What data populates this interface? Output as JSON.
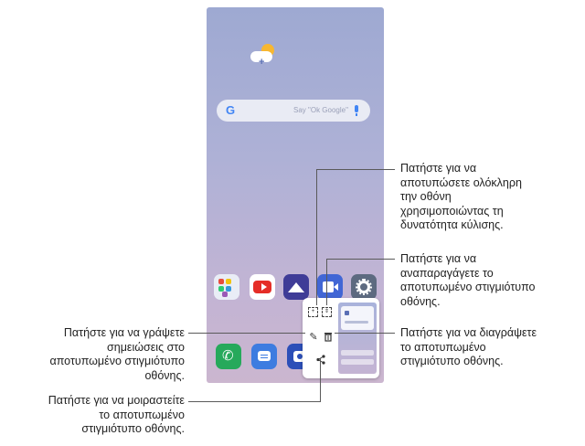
{
  "home_screen": {
    "search_bar": {
      "logo": "G",
      "placeholder": "Say \"Ok Google\""
    },
    "apps_row": [
      "contacts-app",
      "youtube-app",
      "gallery-app",
      "video-app",
      "settings-app"
    ],
    "dock": [
      "phone-app",
      "messages-app",
      "camera-app"
    ]
  },
  "capture_panel": {
    "tools": [
      "capture-plus-icon",
      "extended-capture-icon",
      "edit-icon",
      "delete-icon",
      "share-icon"
    ],
    "glyphs": {
      "edit": "✎",
      "delete": "🗑",
      "share": "<"
    }
  },
  "callouts": {
    "extended": "Πατήστε για να\nαποτυπώσετε ολόκληρη\nτην οθόνη\nχρησιμοποιώντας τη\nδυνατότητα κύλισης.",
    "replay": "Πατήστε για να\nαναπαραγάγετε το\nαποτυπωμένο στιγμιότυπο\nοθόνης.",
    "delete": "Πατήστε για να διαγράψετε\nτο αποτυπωμένο\nστιγμιότυπο οθόνης.",
    "write": "Πατήστε για να γράψετε\nσημειώσεις στο\nαποτυπωμένο στιγμιότυπο\nοθόνης.",
    "share": "Πατήστε για να μοιραστείτε\nτο αποτυπωμένο\nστιγμιότυπο οθόνης."
  }
}
